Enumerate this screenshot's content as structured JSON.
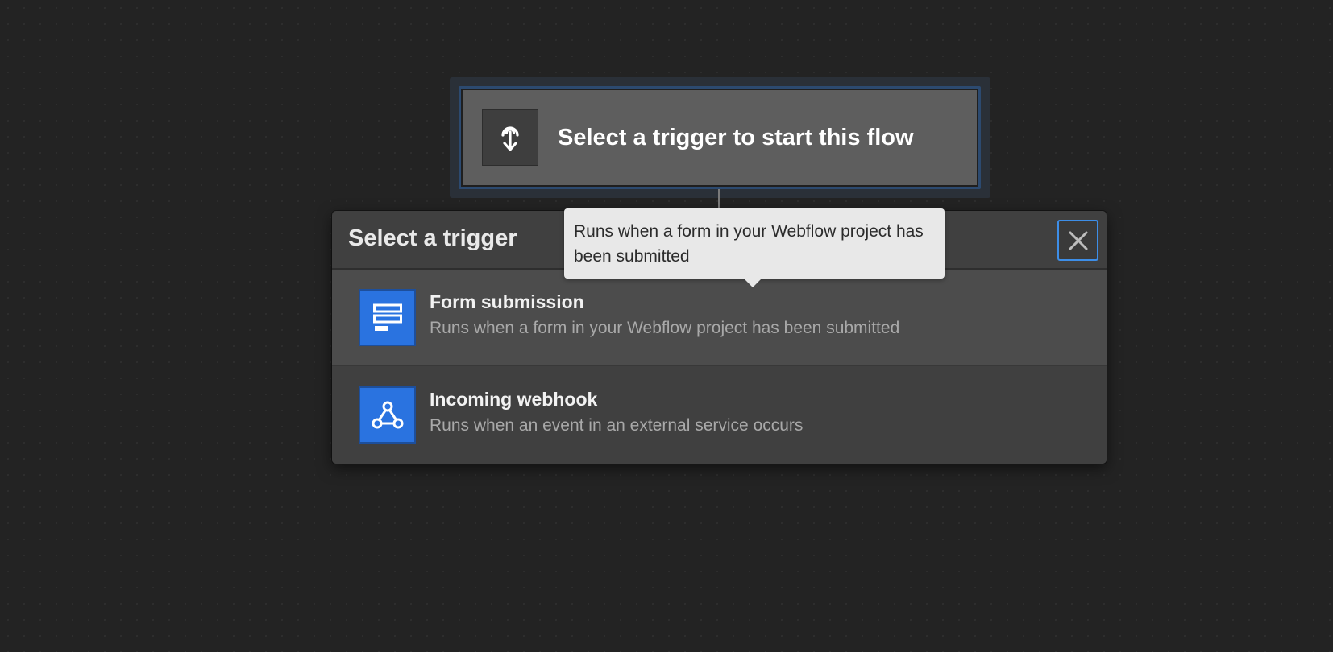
{
  "canvas": {
    "background_color": "#232323"
  },
  "trigger_node": {
    "title": "Select a trigger to start this flow",
    "icon": "trigger-placeholder-icon"
  },
  "panel": {
    "title": "Select a trigger",
    "close_icon": "close-icon",
    "options": [
      {
        "title": "Form submission",
        "description": "Runs when a form in your Webflow project has been submitted",
        "icon": "form-icon",
        "icon_color": "#2a73e0"
      },
      {
        "title": "Incoming webhook",
        "description": "Runs when an event in an external service occurs",
        "icon": "webhook-icon",
        "icon_color": "#2a73e0"
      }
    ]
  },
  "tooltip": {
    "text": "Runs when a form in your Webflow project has been submitted"
  },
  "colors": {
    "accent": "#2a73e0",
    "focus_border": "#3d8ee8"
  }
}
